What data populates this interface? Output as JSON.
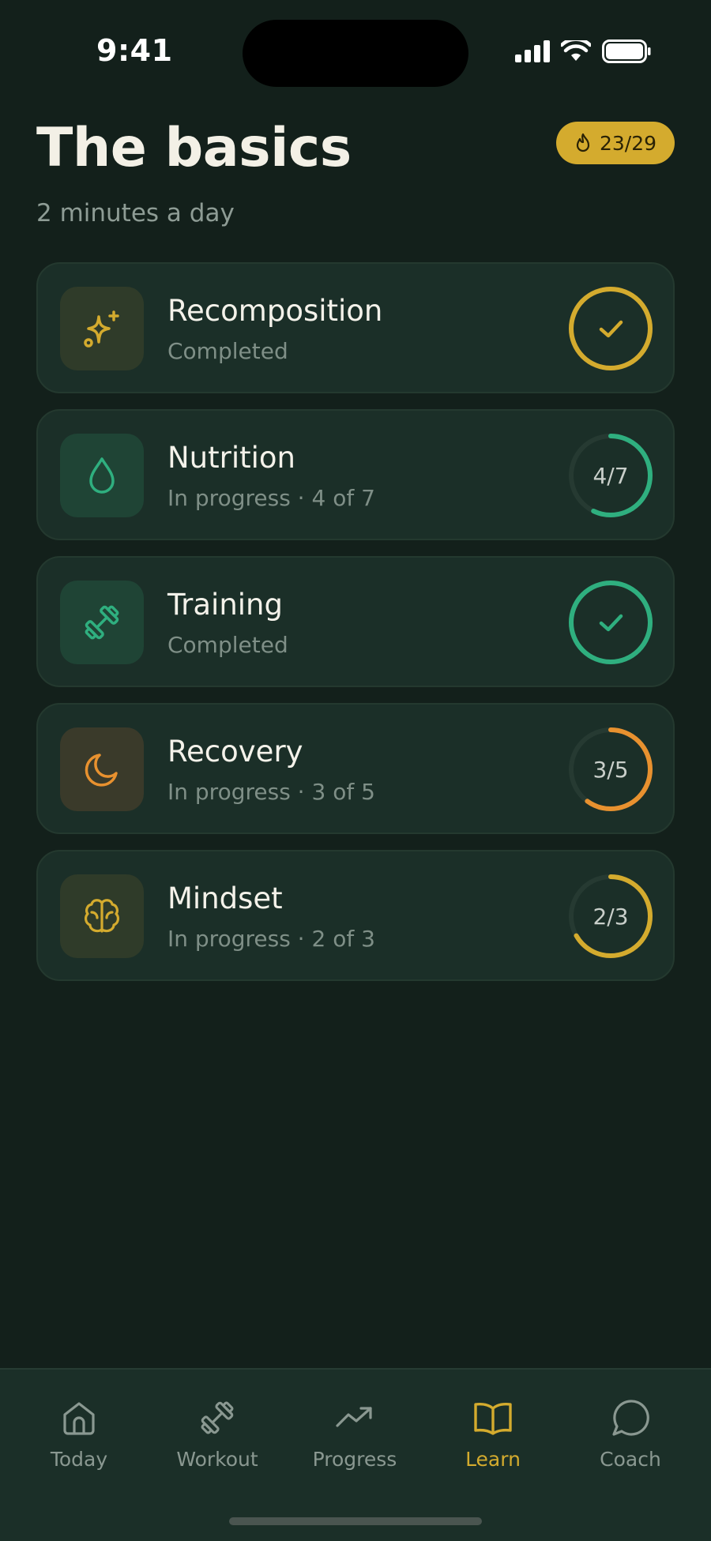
{
  "status_bar": {
    "time": "9:41"
  },
  "header": {
    "title": "The basics",
    "subtitle": "2 minutes a day",
    "streak": {
      "value": "23/29",
      "icon": "flame-icon",
      "color": "#d4ab2e"
    }
  },
  "cards": [
    {
      "title": "Recomposition",
      "subtitle": "Completed",
      "icon": "sparkles-icon",
      "accent": "#d4ab2e",
      "status": "completed",
      "progress": 1.0,
      "ring_text": ""
    },
    {
      "title": "Nutrition",
      "subtitle": "In progress · 4 of 7",
      "icon": "droplet-icon",
      "accent": "#2faf7f",
      "status": "in-progress",
      "progress": 0.571,
      "ring_text": "4/7"
    },
    {
      "title": "Training",
      "subtitle": "Completed",
      "icon": "dumbbell-icon",
      "accent": "#2faf7f",
      "status": "completed",
      "progress": 1.0,
      "ring_text": ""
    },
    {
      "title": "Recovery",
      "subtitle": "In progress · 3 of 5",
      "icon": "moon-icon",
      "accent": "#e8912f",
      "status": "in-progress",
      "progress": 0.6,
      "ring_text": "3/5"
    },
    {
      "title": "Mindset",
      "subtitle": "In progress · 2 of 3",
      "icon": "brain-icon",
      "accent": "#d4ab2e",
      "status": "in-progress",
      "progress": 0.667,
      "ring_text": "2/3"
    }
  ],
  "tabs": [
    {
      "label": "Today",
      "icon": "home-icon",
      "active": false
    },
    {
      "label": "Workout",
      "icon": "dumbbell-icon",
      "active": false
    },
    {
      "label": "Progress",
      "icon": "trend-up-icon",
      "active": false
    },
    {
      "label": "Learn",
      "icon": "book-open-icon",
      "active": true
    },
    {
      "label": "Coach",
      "icon": "chat-bubble-icon",
      "active": false
    }
  ],
  "colors": {
    "background": "#13201b",
    "card": "#1b2f28",
    "accent_gold": "#d4ab2e",
    "accent_green": "#2faf7f",
    "accent_orange": "#e8912f"
  }
}
